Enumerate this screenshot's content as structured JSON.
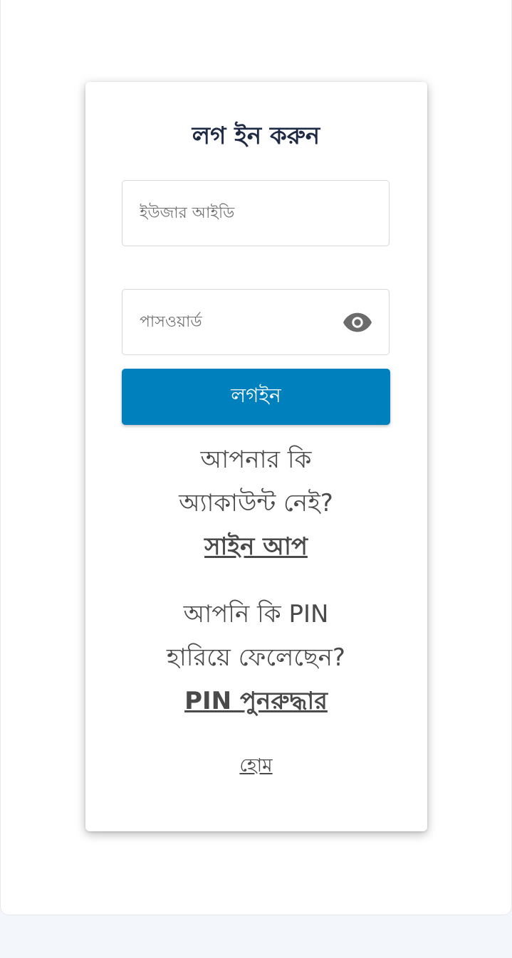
{
  "login": {
    "title": "লগ ইন করুন",
    "userid_placeholder": "ইউজার আইডি",
    "password_placeholder": "পাসওয়ার্ড",
    "password_toggle_icon": "eye-icon",
    "login_button_label": "লগইন",
    "signup_question_line1": "আপনার কি",
    "signup_question_line2": "অ্যাকাউন্ট নেই?",
    "signup_link": "সাইন আপ",
    "pin_question_line1": "আপনি কি PIN",
    "pin_question_line2": "হারিয়ে ফেলেছেন?",
    "pin_recovery_link": "PIN পুনরুদ্ধার",
    "home_link": "হোম"
  },
  "colors": {
    "primary_button": "#0080bd",
    "title_text": "#1f2a44",
    "body_text": "#4a4a4a",
    "background": "#f3f6fa"
  }
}
